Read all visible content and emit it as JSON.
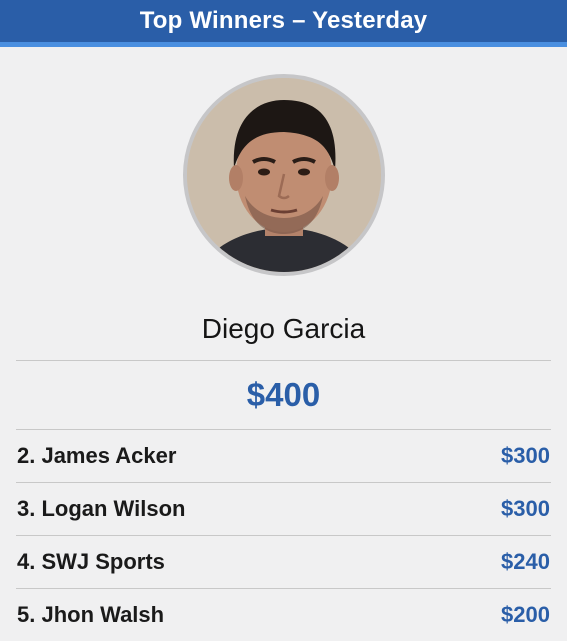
{
  "header": {
    "title": "Top Winners – Yesterday"
  },
  "winner": {
    "name": "Diego Garcia",
    "amount": "$400"
  },
  "runners_up": [
    {
      "name": "2. James Acker",
      "amount": "$300"
    },
    {
      "name": "3. Logan Wilson",
      "amount": "$300"
    },
    {
      "name": "4. SWJ Sports",
      "amount": "$240"
    },
    {
      "name": "5. Jhon Walsh",
      "amount": "$200"
    }
  ],
  "colors": {
    "accent": "#2a5ea8",
    "header_bg": "#2a5ea8",
    "header_underline": "#4a8fe0",
    "page_bg": "#f0f0f1"
  }
}
